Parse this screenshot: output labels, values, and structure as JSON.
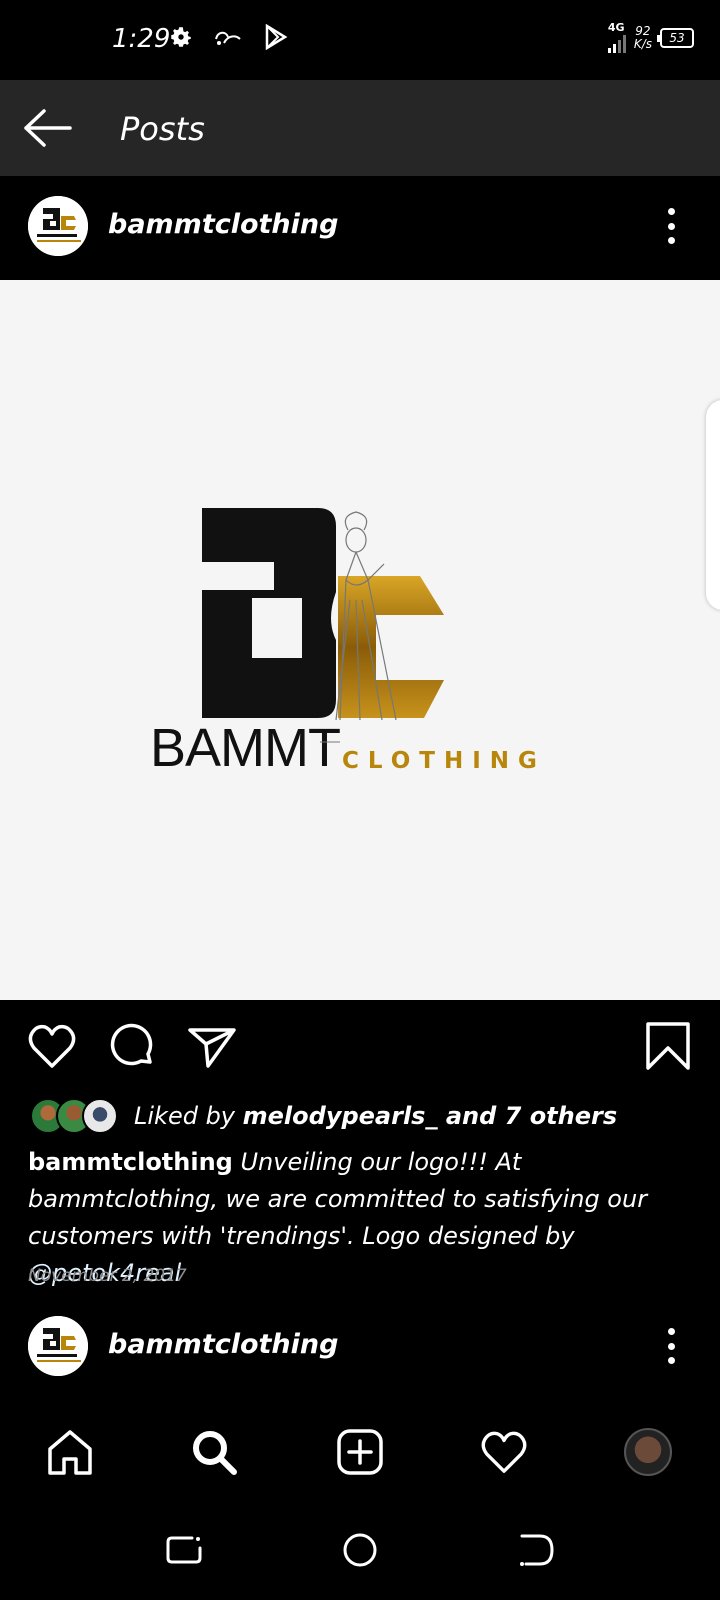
{
  "status_bar": {
    "time": "1:29",
    "network": "4G",
    "speed_value": "92",
    "speed_unit": "K/s",
    "battery": "53",
    "icons": [
      "gear-icon",
      "carrier-icon",
      "play-store-icon"
    ]
  },
  "app_bar": {
    "title": "Posts",
    "back_icon": "arrow-left-icon"
  },
  "post": {
    "username": "bammtclothing",
    "logo_title": "BAMMT",
    "logo_subtitle": "CLOTHING",
    "liked_by_prefix": "Liked by ",
    "liked_by_user": "melodypearls_",
    "liked_by_suffix": " and 7 others",
    "caption_user": "bammtclothing",
    "caption_text": " Unveiling our logo!!! At bammtclothing, we are committed to satisfying our customers with 'trendings'. Logo designed by ",
    "caption_mention": "@petok4real",
    "date": "November 2, 2017"
  },
  "next_post": {
    "username": "bammtclothing"
  },
  "bottom_nav": {
    "items": [
      "home-icon",
      "search-icon",
      "add-post-icon",
      "heart-icon",
      "profile-avatar"
    ]
  },
  "system_nav": {
    "items": [
      "recents-icon",
      "home-circle-icon",
      "back-nav-icon"
    ]
  },
  "colors": {
    "gold": "#B8860B",
    "app_bar_bg": "#262626",
    "image_bg": "#F5F5F5",
    "date_gray": "#8E8E8E"
  }
}
